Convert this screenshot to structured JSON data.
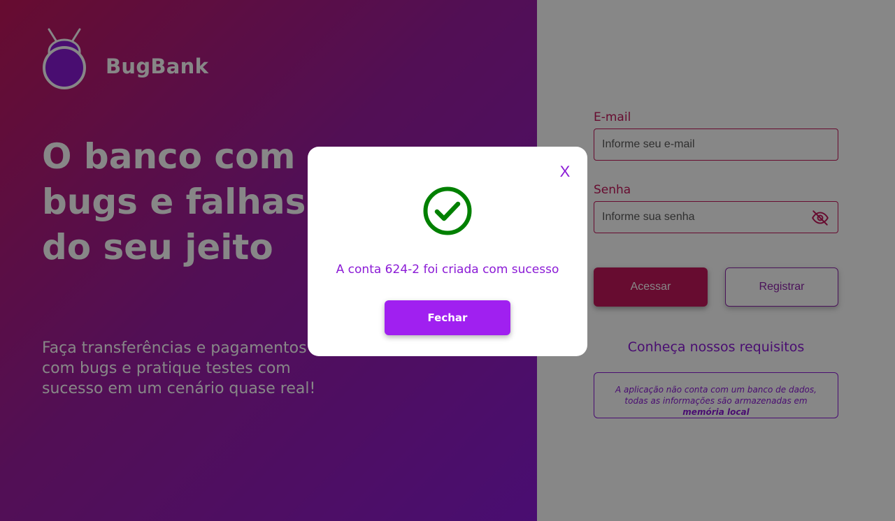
{
  "brand": {
    "name": "BugBank",
    "logo_icon": "bug-icon",
    "logo_color": "#8b1ad6"
  },
  "hero": {
    "headline_lines": [
      "O banco com",
      "bugs e falhas",
      "do seu jeito"
    ],
    "subline": "Faça transferências e pagamentos com bugs e pratique testes com sucesso em um cenário quase real!"
  },
  "login": {
    "email_label": "E-mail",
    "email_placeholder": "Informe seu e-mail",
    "email_value": "",
    "password_label": "Senha",
    "password_placeholder": "Informe sua senha",
    "password_value": "",
    "password_toggle_icon": "eye-off-icon",
    "access_button": "Acessar",
    "register_button": "Registrar",
    "requirements_title": "Conheça nossos requisitos",
    "requirements_text": "A aplicação não conta com um banco de dados, todas as informações são armazenadas em",
    "requirements_emphasis": "memória local"
  },
  "modal": {
    "close_label": "X",
    "status_icon": "check-circle-icon",
    "status_color": "#008000",
    "message": "A conta 624-2 foi criada com sucesso",
    "button_label": "Fechar"
  },
  "colors": {
    "accent_pink": "#c2185b",
    "accent_purple": "#8b1ad6",
    "modal_button": "#a020f0"
  }
}
